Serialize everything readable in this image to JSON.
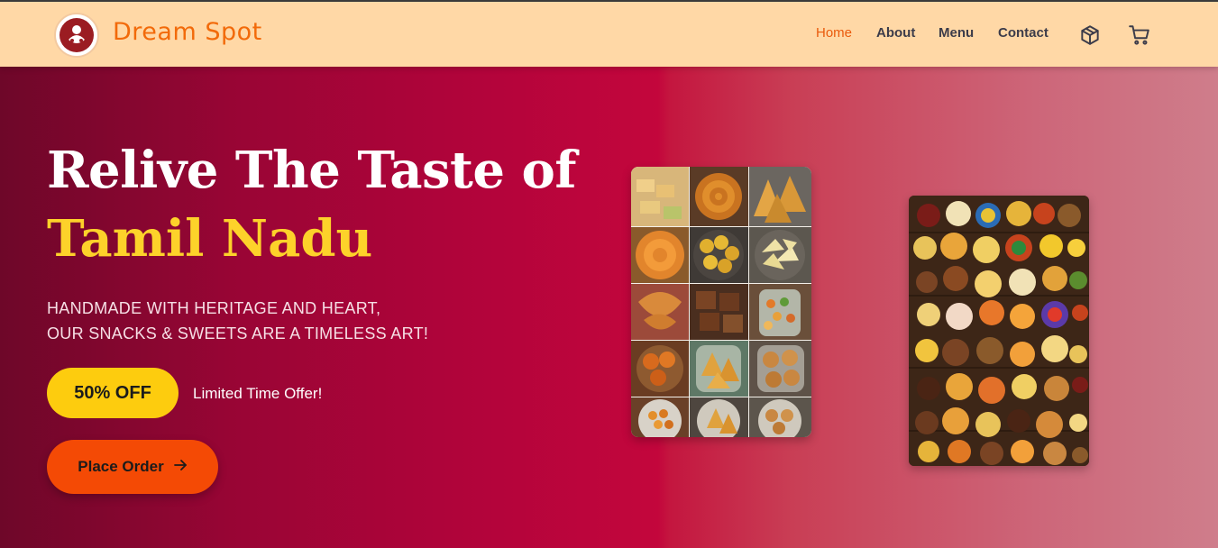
{
  "brand": {
    "name": "Dream Spot",
    "logo_icon": "sweets-logo-icon"
  },
  "nav": {
    "items": [
      {
        "label": "Home",
        "active": true
      },
      {
        "label": "About",
        "active": false
      },
      {
        "label": "Menu",
        "active": false
      },
      {
        "label": "Contact",
        "active": false
      }
    ],
    "icons": [
      "package-icon",
      "cart-icon"
    ]
  },
  "hero": {
    "title_line1": "Relive The Taste of",
    "title_line2": "Tamil Nadu",
    "subtitle_line1": "HANDMADE WITH HERITAGE AND HEART,",
    "subtitle_line2": "OUR SNACKS & SWEETS ARE A TIMELESS ART!",
    "offer_badge": "50% OFF",
    "offer_text": "Limited Time Offer!",
    "cta_label": "Place Order",
    "cta_icon": "arrow-right-icon"
  },
  "colors": {
    "nav_bg": "#ffd8a6",
    "brand": "#f26a0a",
    "active_link": "#ea5a0c",
    "title_accent": "#fdd22a",
    "offer_badge": "#fdcc0e",
    "cta": "#f44a05"
  }
}
